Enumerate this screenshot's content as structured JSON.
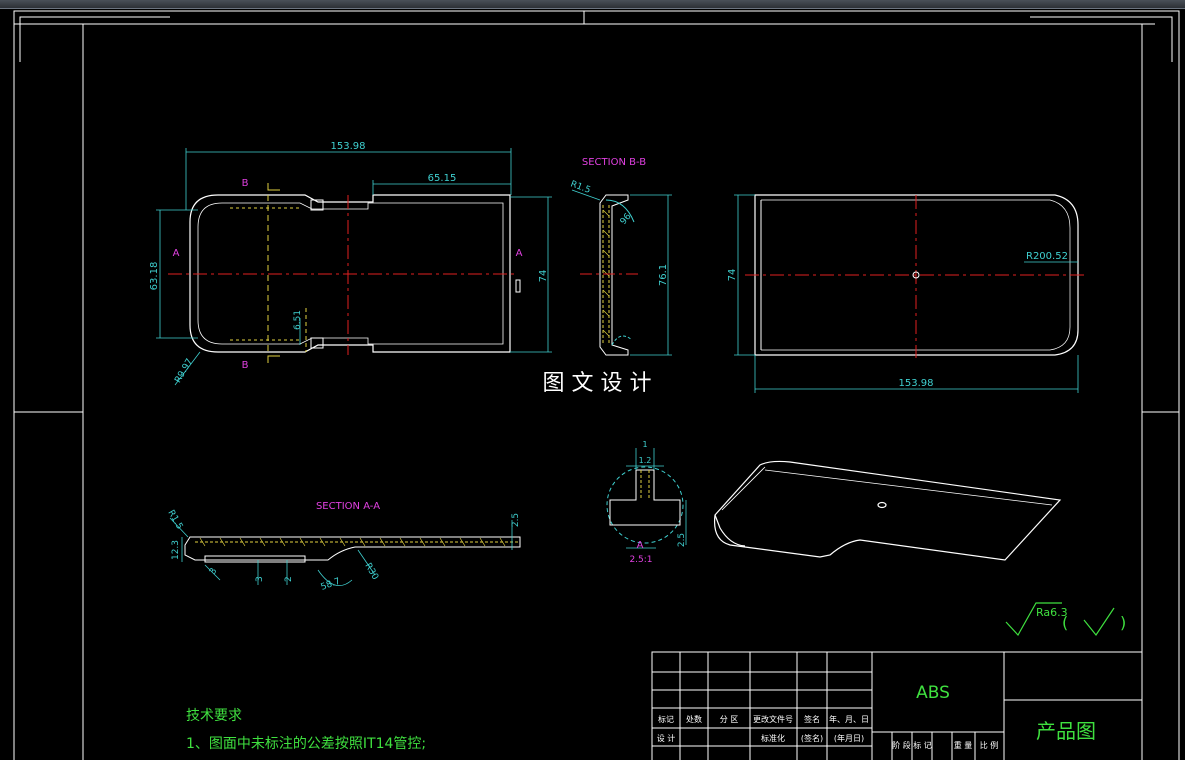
{
  "title_center": "图 文 设 计",
  "views": {
    "top": {
      "overall_width": "153.98",
      "partial_width": "65.15",
      "height_inner": "63.18",
      "height_outer": "74",
      "small_dim": "6.51",
      "radius": "R9.97",
      "label_a_left": "A",
      "label_a_right": "A",
      "label_b_top": "B",
      "label_b_bottom": "B"
    },
    "section_bb": {
      "title": "SECTION B-B",
      "radius": "R1.5",
      "angle": "96",
      "height": "76.1"
    },
    "side": {
      "height": "74",
      "radius": "R200.52",
      "width": "153.98"
    },
    "section_aa": {
      "title": "SECTION A-A",
      "radius": "R1.5",
      "thickness_right": "2.5",
      "height_left": "12.3",
      "dim_3a": "3",
      "dim_3b": "3",
      "dim_2": "2",
      "angle": "58.7",
      "r30": "R30"
    },
    "detail": {
      "top_dim": "1",
      "top_dim2": "1.2",
      "right_dim": "2.5",
      "label": "A",
      "scale": "2.5:1"
    }
  },
  "surface_finish": {
    "text": "Ra6.3",
    "paren_open": "(",
    "paren_close": ")"
  },
  "tech_requirements": {
    "heading": "技术要求",
    "item1": "1、图面中未标注的公差按照IT14管控;"
  },
  "title_block": {
    "material": "ABS",
    "name": "产品图",
    "row_labels": [
      "标记",
      "处数",
      "分 区",
      "更改文件号",
      "签名",
      "年、月、日"
    ],
    "row2_labels": [
      "设 计",
      "",
      "",
      "标准化",
      "(签名)",
      "(年月日)"
    ],
    "stage_labels": [
      "阶 段 标 记",
      "重 量",
      "比 例"
    ]
  },
  "colors": {
    "frame": "#ffffff",
    "dim": "#3fd0d0",
    "center": "#e02020",
    "hidden": "#e0d040",
    "text_green": "#3fe03f",
    "magenta": "#e040e0"
  }
}
